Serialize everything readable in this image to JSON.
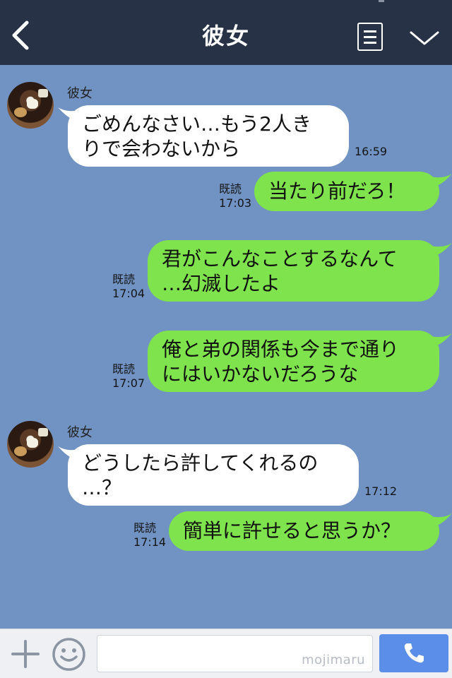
{
  "header": {
    "title": "彼女",
    "icons": {
      "back": "back-arrow-icon",
      "menu": "list-menu-icon",
      "more": "chevron-down-icon"
    }
  },
  "messages": [
    {
      "side": "left",
      "sender": "彼女",
      "lines": [
        "ごめんなさい…もう2人き",
        "りで会わないから"
      ],
      "time": "16:59"
    },
    {
      "side": "right",
      "lines": [
        "当たり前だろ！"
      ],
      "read": "既読",
      "time": "17:03"
    },
    {
      "side": "right",
      "lines": [
        "君がこんなことするなんて",
        "…幻滅したよ"
      ],
      "read": "既読",
      "time": "17:04"
    },
    {
      "side": "right",
      "lines": [
        "俺と弟の関係も今まで通り",
        "にはいかないだろうな"
      ],
      "read": "既読",
      "time": "17:07"
    },
    {
      "side": "left",
      "sender": "彼女",
      "lines": [
        "どうしたら許してくれるの",
        "…？"
      ],
      "time": "17:12"
    },
    {
      "side": "right",
      "lines": [
        "簡単に許せると思うか？"
      ],
      "read": "既読",
      "time": "17:14"
    }
  ],
  "footer": {
    "input_value": "",
    "watermark": "mojimaru",
    "icons": {
      "plus": "plus-icon",
      "sticker": "smiley-icon",
      "call": "phone-icon"
    }
  },
  "colors": {
    "header_bg": "#273246",
    "chat_bg": "#7193c3",
    "bubble_left": "#ffffff",
    "bubble_right": "#7ee34c",
    "send_button": "#5b8ee8"
  }
}
